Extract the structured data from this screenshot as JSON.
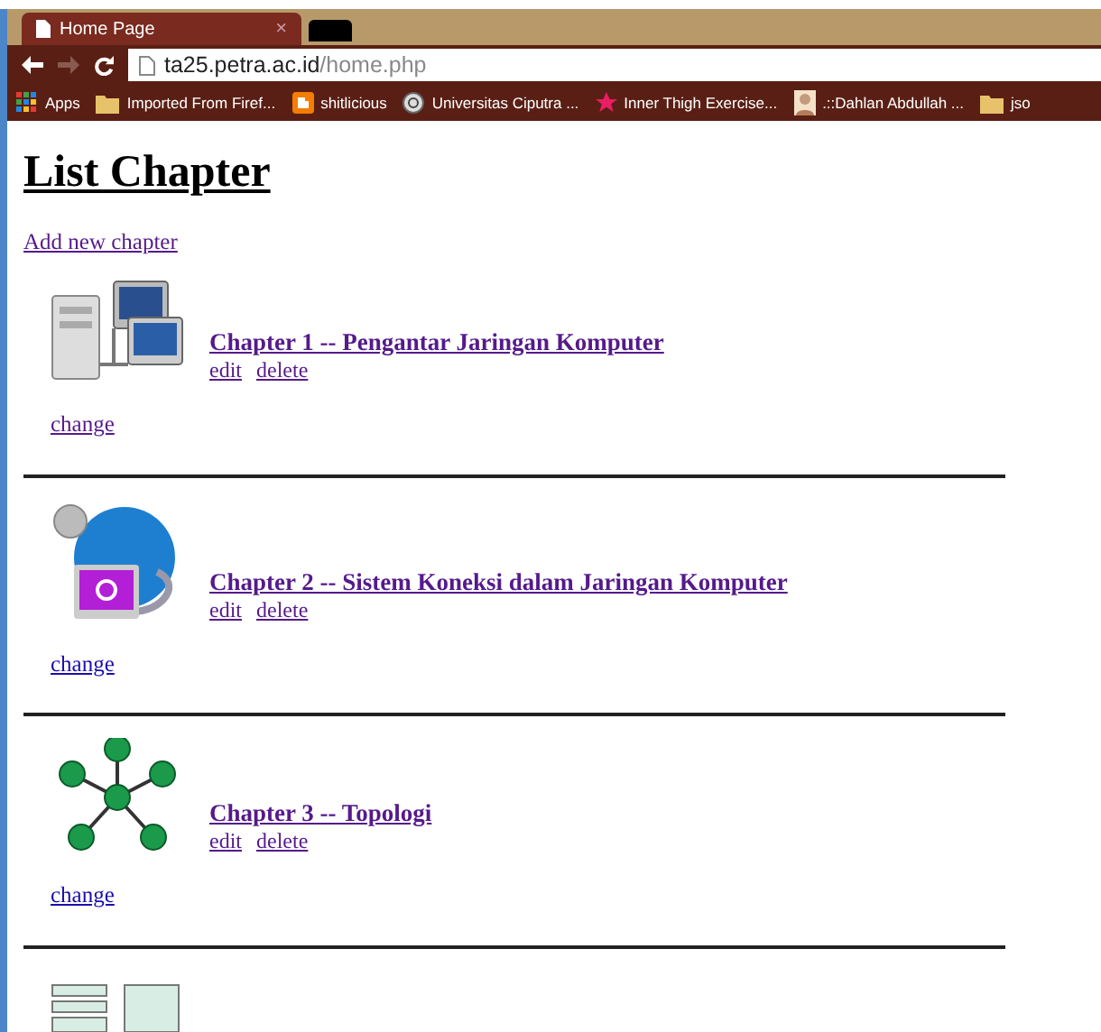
{
  "browser": {
    "tab": {
      "title": "Home Page",
      "close": "×"
    },
    "address": {
      "host": "ta25.petra.ac.id",
      "path": "/home.php"
    },
    "bookmarks": [
      {
        "kind": "apps",
        "label": "Apps"
      },
      {
        "kind": "folder",
        "label": "Imported From Firef..."
      },
      {
        "kind": "blogger",
        "label": "shitlicious"
      },
      {
        "kind": "site",
        "label": "Universitas Ciputra ..."
      },
      {
        "kind": "star",
        "label": "Inner Thigh Exercise..."
      },
      {
        "kind": "avatar",
        "label": ".::Dahlan Abdullah ..."
      },
      {
        "kind": "folder",
        "label": "jso"
      }
    ]
  },
  "page": {
    "heading": "List Chapter",
    "add_link": {
      "label": "Add new chapter",
      "visited": true
    },
    "chapters": [
      {
        "kind": "computers",
        "title": "Chapter 1 -- Pengantar Jaringan Komputer",
        "edit": "edit",
        "delete": "delete",
        "change": {
          "label": "change",
          "visited": true
        }
      },
      {
        "kind": "globe",
        "title": "Chapter 2 -- Sistem Koneksi dalam Jaringan Komputer",
        "edit": "edit",
        "delete": "delete",
        "change": {
          "label": "change",
          "visited": false
        }
      },
      {
        "kind": "star",
        "title": "Chapter 3 -- Topologi",
        "edit": "edit",
        "delete": "delete",
        "change": {
          "label": "change",
          "visited": false
        }
      },
      {
        "kind": "diagram"
      }
    ]
  }
}
